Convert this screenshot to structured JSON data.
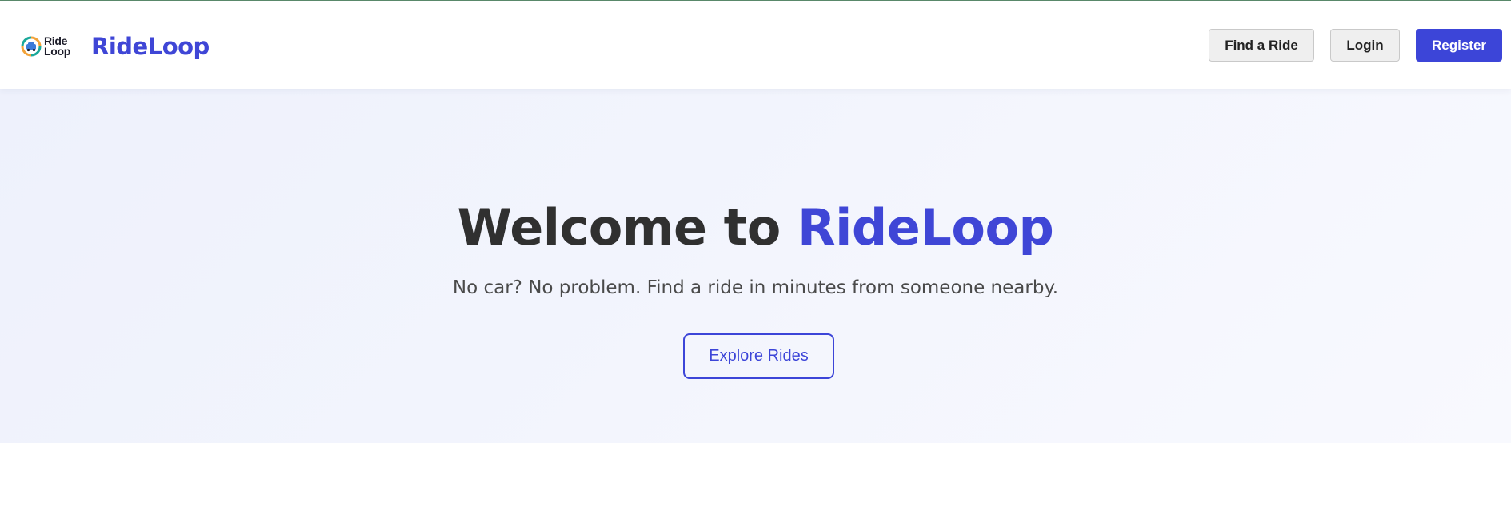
{
  "header": {
    "logo": {
      "line1": "Ride",
      "line2": "Loop",
      "icon": "car-loop-logo-icon"
    },
    "brand_name": "RideLoop",
    "nav": {
      "find_ride_label": "Find a Ride",
      "login_label": "Login",
      "register_label": "Register"
    }
  },
  "hero": {
    "title_prefix": "Welcome to ",
    "title_accent": "RideLoop",
    "subtitle": "No car? No problem. Find a ride in minutes from someone nearby.",
    "cta_label": "Explore Rides"
  },
  "colors": {
    "brand": "#3f46d6",
    "primary_button": "#3c45d8",
    "hero_background": "#eef1fc",
    "logo_ring_teal": "#1aa89a",
    "logo_ring_orange": "#f2a33a",
    "logo_car": "#3b7ad9"
  }
}
